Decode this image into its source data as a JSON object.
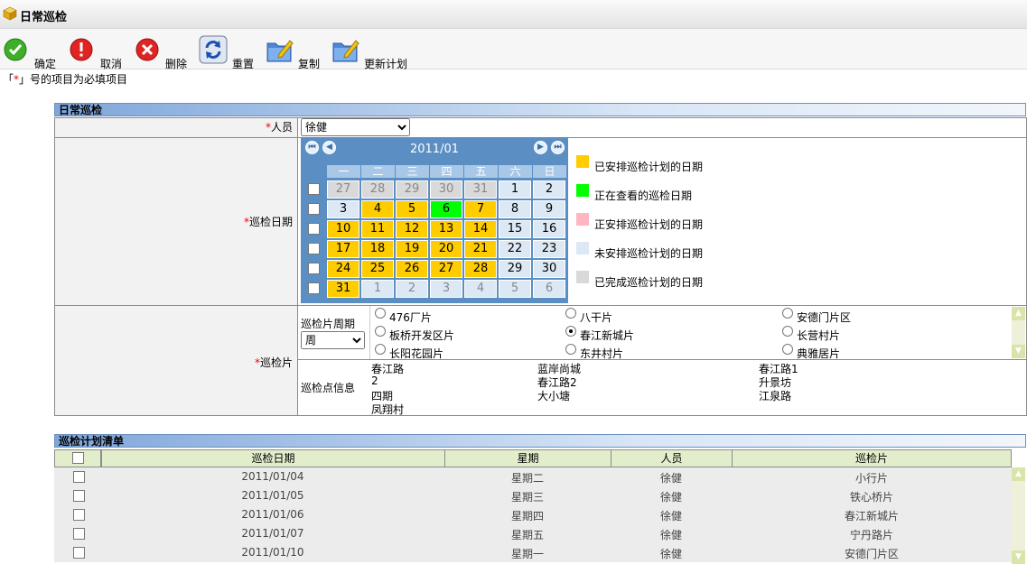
{
  "title": "日常巡检",
  "toolbar": {
    "confirm": "确定",
    "cancel": "取消",
    "delete": "删除",
    "reset": "重置",
    "copy": "复制",
    "update_plan": "更新计划"
  },
  "note": {
    "pre": "「",
    "star": "*",
    "post": "」号的项目为必填项目"
  },
  "section1": "日常巡检",
  "form": {
    "star": "*",
    "person_label": "人员",
    "person_value": "徐健",
    "date_label": "巡检日期",
    "area_label": "巡检片"
  },
  "calendar": {
    "month": "2011/01",
    "weekdays": [
      "一",
      "二",
      "三",
      "四",
      "五",
      "六",
      "日"
    ],
    "weeks": [
      [
        [
          "27",
          "past"
        ],
        [
          "28",
          "past"
        ],
        [
          "29",
          "past"
        ],
        [
          "30",
          "past"
        ],
        [
          "31",
          "past"
        ],
        [
          "1",
          "none"
        ],
        [
          "2",
          "none"
        ]
      ],
      [
        [
          "3",
          "none"
        ],
        [
          "4",
          "planned"
        ],
        [
          "5",
          "planned"
        ],
        [
          "6",
          "viewing"
        ],
        [
          "7",
          "planned"
        ],
        [
          "8",
          "none"
        ],
        [
          "9",
          "none"
        ]
      ],
      [
        [
          "10",
          "planned"
        ],
        [
          "11",
          "planned"
        ],
        [
          "12",
          "planned"
        ],
        [
          "13",
          "planned"
        ],
        [
          "14",
          "planned"
        ],
        [
          "15",
          "none"
        ],
        [
          "16",
          "none"
        ]
      ],
      [
        [
          "17",
          "planned"
        ],
        [
          "18",
          "planned"
        ],
        [
          "19",
          "planned"
        ],
        [
          "20",
          "planned"
        ],
        [
          "21",
          "planned"
        ],
        [
          "22",
          "none"
        ],
        [
          "23",
          "none"
        ]
      ],
      [
        [
          "24",
          "planned"
        ],
        [
          "25",
          "planned"
        ],
        [
          "26",
          "planned"
        ],
        [
          "27",
          "planned"
        ],
        [
          "28",
          "planned"
        ],
        [
          "29",
          "none"
        ],
        [
          "30",
          "none"
        ]
      ],
      [
        [
          "31",
          "planned"
        ],
        [
          "1",
          "next"
        ],
        [
          "2",
          "next"
        ],
        [
          "3",
          "next"
        ],
        [
          "4",
          "next"
        ],
        [
          "5",
          "next"
        ],
        [
          "6",
          "next"
        ]
      ]
    ]
  },
  "colors": {
    "planned": "#ffcc00",
    "viewing": "#00ff00",
    "arranging": "#ffb6c1",
    "none": "#dce9f5",
    "done": "#d9d9d9"
  },
  "legend": [
    {
      "color": "#ffcc00",
      "label": "已安排巡检计划的日期"
    },
    {
      "color": "#00ff00",
      "label": "正在查看的巡检日期"
    },
    {
      "color": "#ffb6c1",
      "label": "正安排巡检计划的日期"
    },
    {
      "color": "#dce9f5",
      "label": "未安排巡检计划的日期"
    },
    {
      "color": "#d9d9d9",
      "label": "已完成巡检计划的日期"
    }
  ],
  "cycle": {
    "label": "巡检片周期",
    "value": "周"
  },
  "areas": [
    {
      "label": "476厂片",
      "checked": false
    },
    {
      "label": "八干片",
      "checked": false
    },
    {
      "label": "安德门片区",
      "checked": false
    },
    {
      "label": "板桥开发区片",
      "checked": false
    },
    {
      "label": "春江新城片",
      "checked": true
    },
    {
      "label": "长营村片",
      "checked": false
    },
    {
      "label": "长阳花园片",
      "checked": false
    },
    {
      "label": "东井村片",
      "checked": false
    },
    {
      "label": "典雅居片",
      "checked": false
    }
  ],
  "points": {
    "label": "巡检点信息",
    "col1": [
      "春江路",
      "2",
      "四期",
      "凤翔村"
    ],
    "col2": [
      "蓝岸尚城",
      "春江路2",
      "大小塘"
    ],
    "col3": [
      "春江路1",
      "升景坊",
      "江泉路"
    ]
  },
  "section2": "巡检计划清单",
  "plan": {
    "headers": [
      "巡检日期",
      "星期",
      "人员",
      "巡检片"
    ],
    "rows": [
      [
        "2011/01/04",
        "星期二",
        "徐健",
        "小行片"
      ],
      [
        "2011/01/05",
        "星期三",
        "徐健",
        "铁心桥片"
      ],
      [
        "2011/01/06",
        "星期四",
        "徐健",
        "春江新城片"
      ],
      [
        "2011/01/07",
        "星期五",
        "徐健",
        "宁丹路片"
      ],
      [
        "2011/01/10",
        "星期一",
        "徐健",
        "安德门片区"
      ]
    ]
  }
}
